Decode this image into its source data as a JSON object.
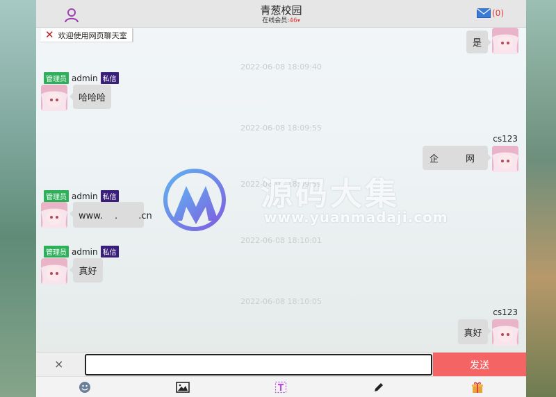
{
  "header": {
    "title": "青葱校园",
    "online_label": "在线会员:",
    "online_count": "46",
    "mail_count": "(0)"
  },
  "welcome_tab": {
    "label": "欢迎使用网页聊天室"
  },
  "messages": [
    {
      "side": "right",
      "text": "是"
    },
    {
      "timestamp": "2022-06-08 18:09:40"
    },
    {
      "side": "left",
      "role_badge": "管理员",
      "name": "admin",
      "pm_badge": "私信",
      "text": "哈哈哈"
    },
    {
      "timestamp": "2022-06-08 18:09:55"
    },
    {
      "side": "right",
      "name": "cs123",
      "text": "企　　　网"
    },
    {
      "timestamp": "2022-06-08 18:09:59"
    },
    {
      "side": "left",
      "role_badge": "管理员",
      "name": "admin",
      "pm_badge": "私信",
      "text": "www.　 .　　 .cn"
    },
    {
      "timestamp": "2022-06-08 18:10:01"
    },
    {
      "side": "left",
      "role_badge": "管理员",
      "name": "admin",
      "pm_badge": "私信",
      "text": "真好"
    },
    {
      "timestamp": "2022-06-08 18:10:05"
    },
    {
      "side": "right",
      "name": "cs123",
      "text": "真好"
    }
  ],
  "watermark": {
    "text": "源码大集",
    "url": "www.yuanmadaji.com"
  },
  "input": {
    "clear": "×",
    "value": "",
    "send_label": "发送"
  },
  "toolbar": {
    "icons": [
      "emoji-icon",
      "image-icon",
      "text-style-icon",
      "pen-icon",
      "gift-icon"
    ]
  },
  "colors": {
    "send": "#f56464",
    "admin_badge": "#2eaf5a",
    "pm_badge": "#3a1f7a",
    "online_count": "#e53935"
  }
}
